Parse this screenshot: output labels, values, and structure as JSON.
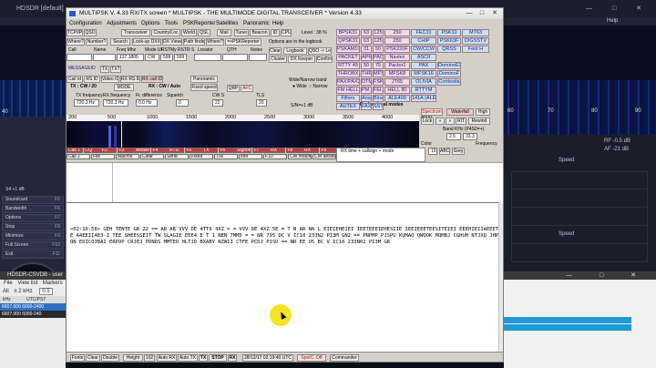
{
  "background_app": {
    "title": "HDSDR  [default]",
    "title_controls": [
      "—",
      "□",
      "✕"
    ],
    "menu": [
      "Help"
    ],
    "left_scale": "40",
    "right_scale": [
      "60",
      "70",
      "80",
      "90"
    ],
    "right_labels": [
      "RF -0.5 dB",
      "AF -21 dB",
      "Speed",
      "Speed"
    ],
    "side_buttons": [
      {
        "label": "Soundcard",
        "key": "F5"
      },
      {
        "label": "Bandwidth",
        "key": "F6"
      },
      {
        "label": "Options",
        "key": "F7"
      },
      {
        "label": "Stop",
        "key": "F8"
      },
      {
        "label": "Minimize",
        "key": "F9"
      },
      {
        "label": "Full Screen",
        "key": "F10"
      },
      {
        "label": "Exit",
        "key": "F11"
      }
    ],
    "meter_label": "S4 +1 dB",
    "csv_window": {
      "title": "HDSDR-CSVDB - user",
      "menu": [
        "File",
        "View list",
        "Markers"
      ],
      "filter_label": "All",
      "filter_value": "± 2 kHz",
      "filter_value2": "0.5",
      "columns": [
        "kHz",
        "UTC/PST"
      ],
      "rows": [
        "6607.000 6000-2400",
        "6607.000 6000-240"
      ]
    }
  },
  "multipsk": {
    "title": "MULTIPSK V. 4.33     RX/TX screen  * MULTIPSK - THE MULTIMODE DIGITAL TRANSCEIVER *   Version 4.33",
    "window_controls": [
      "—",
      "□",
      "✕"
    ],
    "menu": [
      "Configuration",
      "Adjustments",
      "Options",
      "Tools",
      "PSKReporter",
      "Satellites",
      "Panoramic",
      "Help"
    ],
    "toolbar_row1": [
      "TCP/IP",
      "QSO",
      "Transceiver",
      "Country/Loc",
      "World",
      "QSL",
      "Mail",
      "Tuner",
      "Beacon",
      "ID",
      "CPU"
    ],
    "toolbar_row2": [
      "Where?",
      "Number?",
      "Search",
      "Look-up DXX",
      "DX Viewer",
      "Path finder",
      "Where?",
      "=>PSKReporter"
    ],
    "logbook_options": "Options are in the logbook",
    "level_label": "Level : 38 %",
    "qso_fields_labels": [
      "Call",
      "Name",
      "Freq Mhz",
      "Mode Uf",
      "RST",
      "My RST",
      "R S",
      "Locator",
      "QTH",
      "Notes"
    ],
    "freq_value": "137.1805",
    "mode_value": "CW",
    "rst_value": "599",
    "my_rst_value": "599",
    "log_buttons": [
      "Clear",
      "Logbook",
      "QSO -> Log",
      "Cluster",
      "DX Keeper",
      "Confirm"
    ],
    "macro_label": "MESSAGEID",
    "tx_label": "TX",
    "txt_label": "TXT",
    "call_buttons": [
      "Call Id",
      "RS ID",
      "Video ID",
      "RX RS ID",
      "RX call ID"
    ],
    "panoramic_label": "Panoramic",
    "fixed_speed_label": "Fixed speed",
    "tx_mode_label": "TX : CW / 20",
    "rx_mode_label": "RX : CW / Auto",
    "mode_label": "MODE",
    "wide_narrow_label": "Wide/Narrow band",
    "wide_label": "Wide",
    "narrow_label": "Narrow",
    "tx_freq_label": "TX frequency",
    "rx_freq_label": "RX frequency",
    "freq_diff_label": "Fr. difference",
    "squelch_label": "Squelch",
    "cw_s_label": "CW S",
    "tls_label": "TLS",
    "tx_freq": "720.3 Hz",
    "rx_freq": "720.3 Hz",
    "freq_diff": "0.0 Hz",
    "squelch": "0",
    "cw_s": "22",
    "tls": "20",
    "qrp_label": "QRP",
    "afc_label": "AFC",
    "sn_label": "S/N=+1 dB",
    "mode_buttons": [
      [
        "BPSK31",
        "63",
        "125",
        "250",
        "FEC31",
        "PSK10",
        "MT63"
      ],
      [
        "QPSK31",
        "63",
        "125",
        "250",
        "CHIP",
        "PSK63F",
        "DIGSSTV"
      ],
      [
        "PSKAM10",
        "31",
        "50",
        "PSK220F",
        "CW/CCW",
        "QRSS",
        "Feld H"
      ],
      [
        "PACKET",
        "APRS",
        "PACTOR 1",
        "Navtex",
        "ASCII",
        "",
        ""
      ],
      [
        "RTTY 45",
        "50",
        "75",
        "Pactor1",
        "PAX",
        "DominoEX",
        ""
      ],
      [
        "THROBX",
        "THROB",
        "MFSK+PIC",
        "MFSK8",
        "MFSK16",
        "DominoF",
        ""
      ],
      [
        "PAX/PAX2",
        "DTMF",
        "FSK+HELL",
        "JT65",
        "OLIVIA",
        "Contestia",
        ""
      ],
      [
        "FM HELL",
        "PM HELL",
        "FELD HELL",
        "HELL 80",
        "RTTYM",
        "",
        ""
      ],
      [
        "Filters",
        "Analysis",
        "Binaural",
        "ALE400",
        "141A (ALE)",
        "",
        ""
      ],
      [
        "AUTEX",
        "FAX",
        "SSTV",
        "",
        "",
        "",
        ""
      ]
    ],
    "professional_modes": "Professional modes",
    "spectrum_scale": [
      "200",
      "500",
      "1000",
      "1500",
      "2000",
      "2500",
      "3000",
      "3500",
      "4000",
      "4500"
    ],
    "spectrum_button": "Spectrum",
    "waterfall_button": "Waterfall",
    "high_label": "High",
    "lock_label": "Lock",
    "rewind_label": "Rewind",
    "rit_label": "RIT",
    "band_khz_label": "Band KHz (P4S0=+)",
    "band_value": "2.5",
    "offset_value": "33.3",
    "color_label": "Color",
    "color_value": "10",
    "freq_label": "Frequency",
    "abc_label": "ABC",
    "grey_label": "Grey",
    "macros_top": [
      "Call 1",
      "CQ",
      "F2",
      "F3",
      "Answer",
      "F4",
      "RTU",
      "F5",
      "TX",
      "F6",
      "Signoff",
      "F7",
      "RX",
      "F8",
      "RX",
      "F9"
    ],
    "macros_bottom": [
      "Call 2",
      "File",
      "Macros",
      "Clear",
      "Send",
      "Fixed",
      "T/R",
      "Info",
      "F10",
      "CW mod/file",
      "CW answer"
    ],
    "rx_time_label": "RX time + callsign + mode",
    "rx_text": "<02:16:58> GEH TENTE GR 22 == AR AR VVV DE 4TT6 4XZ = = VVV DE 4XZ 5E = T N AR NA L EIEIEHEIEI IEETEEEIEHESIIE IEEIEEETEESITEIEI EEEHIEIIAEEETE A4EEII4E3-I TEE SHEESSEIT TW SLAGIE EEE4 E T 1 NEN 7MM5 = = NR 795 DC V IC10 233N2 PI3M GN2 == PNPMP PJSPU KUMAO QWQOK MQMBJ CGHUH NTJXQ JHPQN EDICOJBAI ERPOP CRJEJ PDNDS MMTEO HLTJD BXABY NZWII CTFE PCDJ PJSU == NR EE O5 BC V IC10 233N02 PI3M GR",
    "status_bar": [
      "Fonts",
      "Clear",
      "Double",
      "Height",
      "102",
      "Auto RX",
      "Auto TX",
      "TX",
      "STOP",
      "RX",
      "28/12/17  02:19:40 UTC",
      "SpotC..Off",
      "Commander"
    ]
  },
  "colors": {
    "mode_pink": "#f6d8e6",
    "mode_blue": "#c9e2ef",
    "macro_red": "#c43c3c",
    "cursor_highlight": "#f3e10a"
  }
}
